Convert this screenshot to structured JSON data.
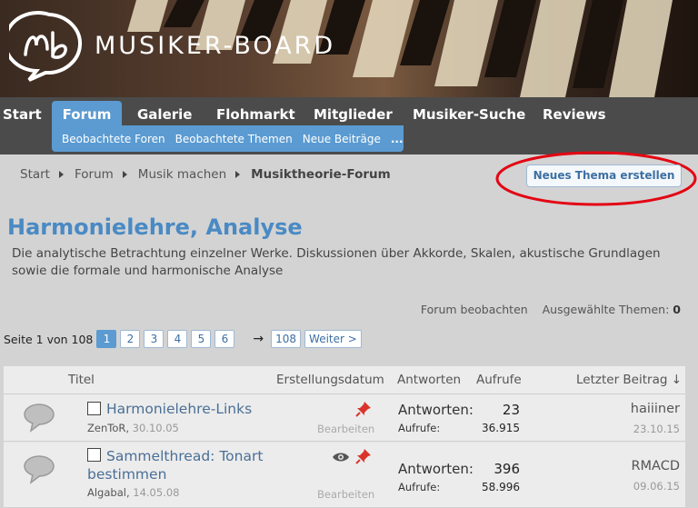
{
  "site": {
    "logo_text": "MUSIKER-BOARD"
  },
  "nav": {
    "tabs": [
      "Start",
      "Forum",
      "Galerie",
      "Flohmarkt",
      "Mitglieder",
      "Musiker-Suche",
      "Reviews"
    ],
    "subnav": [
      "Beobachtete Foren",
      "Beobachtete Themen",
      "Neue Beiträge",
      "..."
    ]
  },
  "breadcrumb": [
    "Start",
    "Forum",
    "Musik machen",
    "Musiktheorie-Forum"
  ],
  "new_thread_button": "Neues Thema erstellen",
  "forum": {
    "title": "Harmonielehre, Analyse",
    "description": "Die analytische Betrachtung einzelner Werke. Diskussionen über Akkorde, Skalen, akustische Grundlagen sowie die formale und harmonische Analyse"
  },
  "tools": {
    "watch": "Forum beobachten",
    "selected_label": "Ausgewählte Themen:",
    "selected_count": "0"
  },
  "pagination": {
    "label": "Seite 1 von 108",
    "pages": [
      "1",
      "2",
      "3",
      "4",
      "5",
      "6"
    ],
    "arrow": "→",
    "last": "108",
    "next": "Weiter >"
  },
  "table": {
    "headers": {
      "title": "Titel",
      "created": "Erstellungsdatum",
      "replies": "Antworten",
      "views": "Aufrufe",
      "last": "Letzter Beitrag ↓"
    },
    "rows": [
      {
        "title": "Harmonielehre-Links",
        "author": "ZenToR,",
        "date": "30.10.05",
        "edit": "Bearbeiten",
        "replies_label": "Antworten:",
        "replies": "23",
        "views_label": "Aufrufe:",
        "views": "36.915",
        "last_user": "haiiiner",
        "last_date": "23.10.15"
      },
      {
        "title": "Sammelthread: Tonart bestimmen",
        "author": "Algabal,",
        "date": "14.05.08",
        "edit": "Bearbeiten",
        "replies_label": "Antworten:",
        "replies": "396",
        "views_label": "Aufrufe:",
        "views": "58.996",
        "last_user": "RMACD",
        "last_date": "09.06.15"
      }
    ]
  },
  "colors": {
    "accent": "#5b9bd1",
    "navbar": "#4b4b4b",
    "highlight_ellipse": "#e30613",
    "pin": "#d9342b"
  }
}
